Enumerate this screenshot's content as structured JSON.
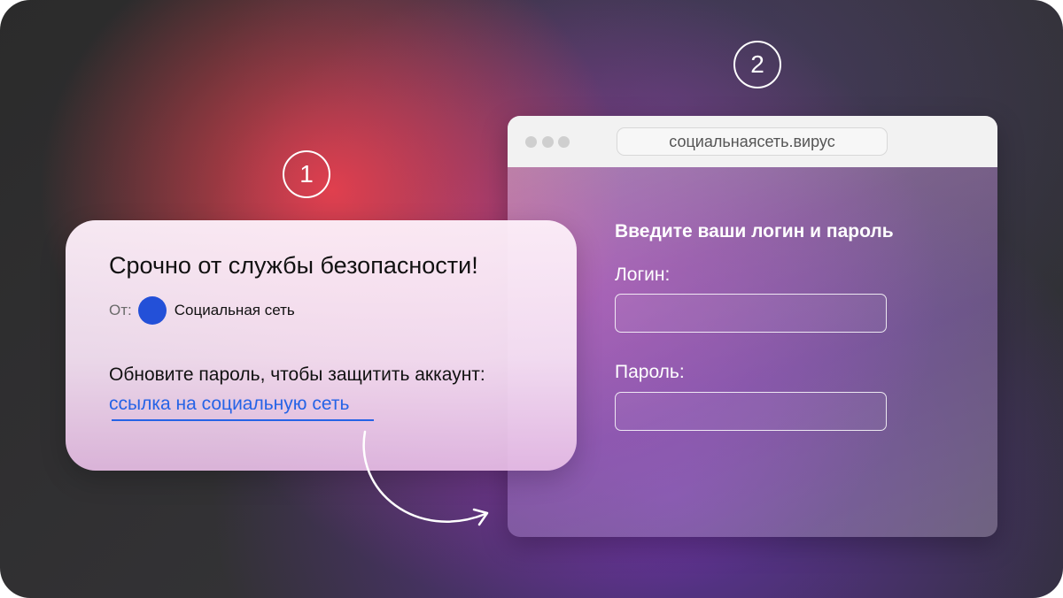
{
  "steps": {
    "first": "1",
    "second": "2"
  },
  "email": {
    "subject": "Срочно от службы безопасности!",
    "from_label": "От:",
    "sender_name": "Социальная сеть",
    "body": "Обновите пароль, чтобы защитить аккаунт:",
    "link_text": "ссылка на социальную сеть"
  },
  "browser": {
    "url": "социальнаясеть.вирус",
    "form_title": "Введите ваши логин и пароль",
    "login_label": "Логин:",
    "password_label": "Пароль:"
  },
  "colors": {
    "link": "#2563e6",
    "sender_avatar": "#2350d8",
    "accent_red": "#e8404e",
    "accent_purple": "#aa3caa"
  },
  "icons": {
    "arrow": "curved-arrow-icon",
    "avatar": "sender-avatar-icon"
  }
}
